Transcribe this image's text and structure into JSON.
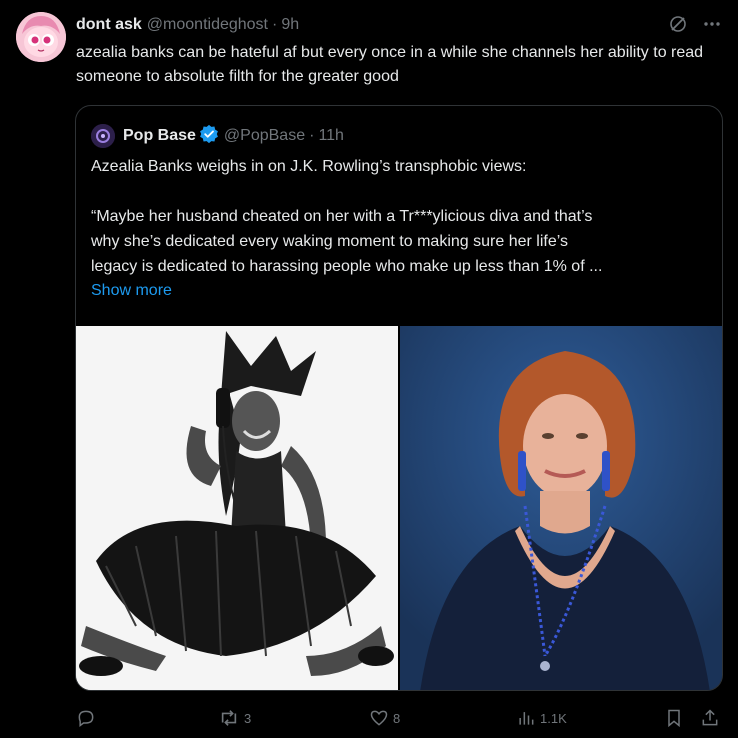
{
  "tweet": {
    "author_name": "dont ask",
    "author_handle": "@moontideghost",
    "separator": "·",
    "time": "9h",
    "text": "azealia banks can be hateful af but every once in a while she channels her ability to read someone to absolute filth for the greater good"
  },
  "quote": {
    "author_name": "Pop Base",
    "author_handle": "@PopBase",
    "separator": "·",
    "time": "11h",
    "line1": "Azealia Banks weighs in on J.K. Rowling’s transphobic views:",
    "line2": "“Maybe her husband cheated on her with a Tr***ylicious diva and that’s",
    "line3": "why she’s dedicated every waking moment to making sure her life’s",
    "line4": "legacy is dedicated to harassing people who make up less than 1% of ...",
    "show_more": "Show more"
  },
  "actions": {
    "replies": "",
    "reposts": "3",
    "likes": "8",
    "views": "1.1K"
  },
  "icons": {
    "grok": "grok-icon",
    "more": "more-icon",
    "reply": "reply-icon",
    "repost": "repost-icon",
    "like": "heart-icon",
    "views": "views-icon",
    "bookmark": "bookmark-icon",
    "share": "share-icon"
  },
  "colors": {
    "background": "#000000",
    "text": "#e7e9ea",
    "muted": "#71767b",
    "link": "#1d9bf0",
    "border": "#2f3336"
  }
}
